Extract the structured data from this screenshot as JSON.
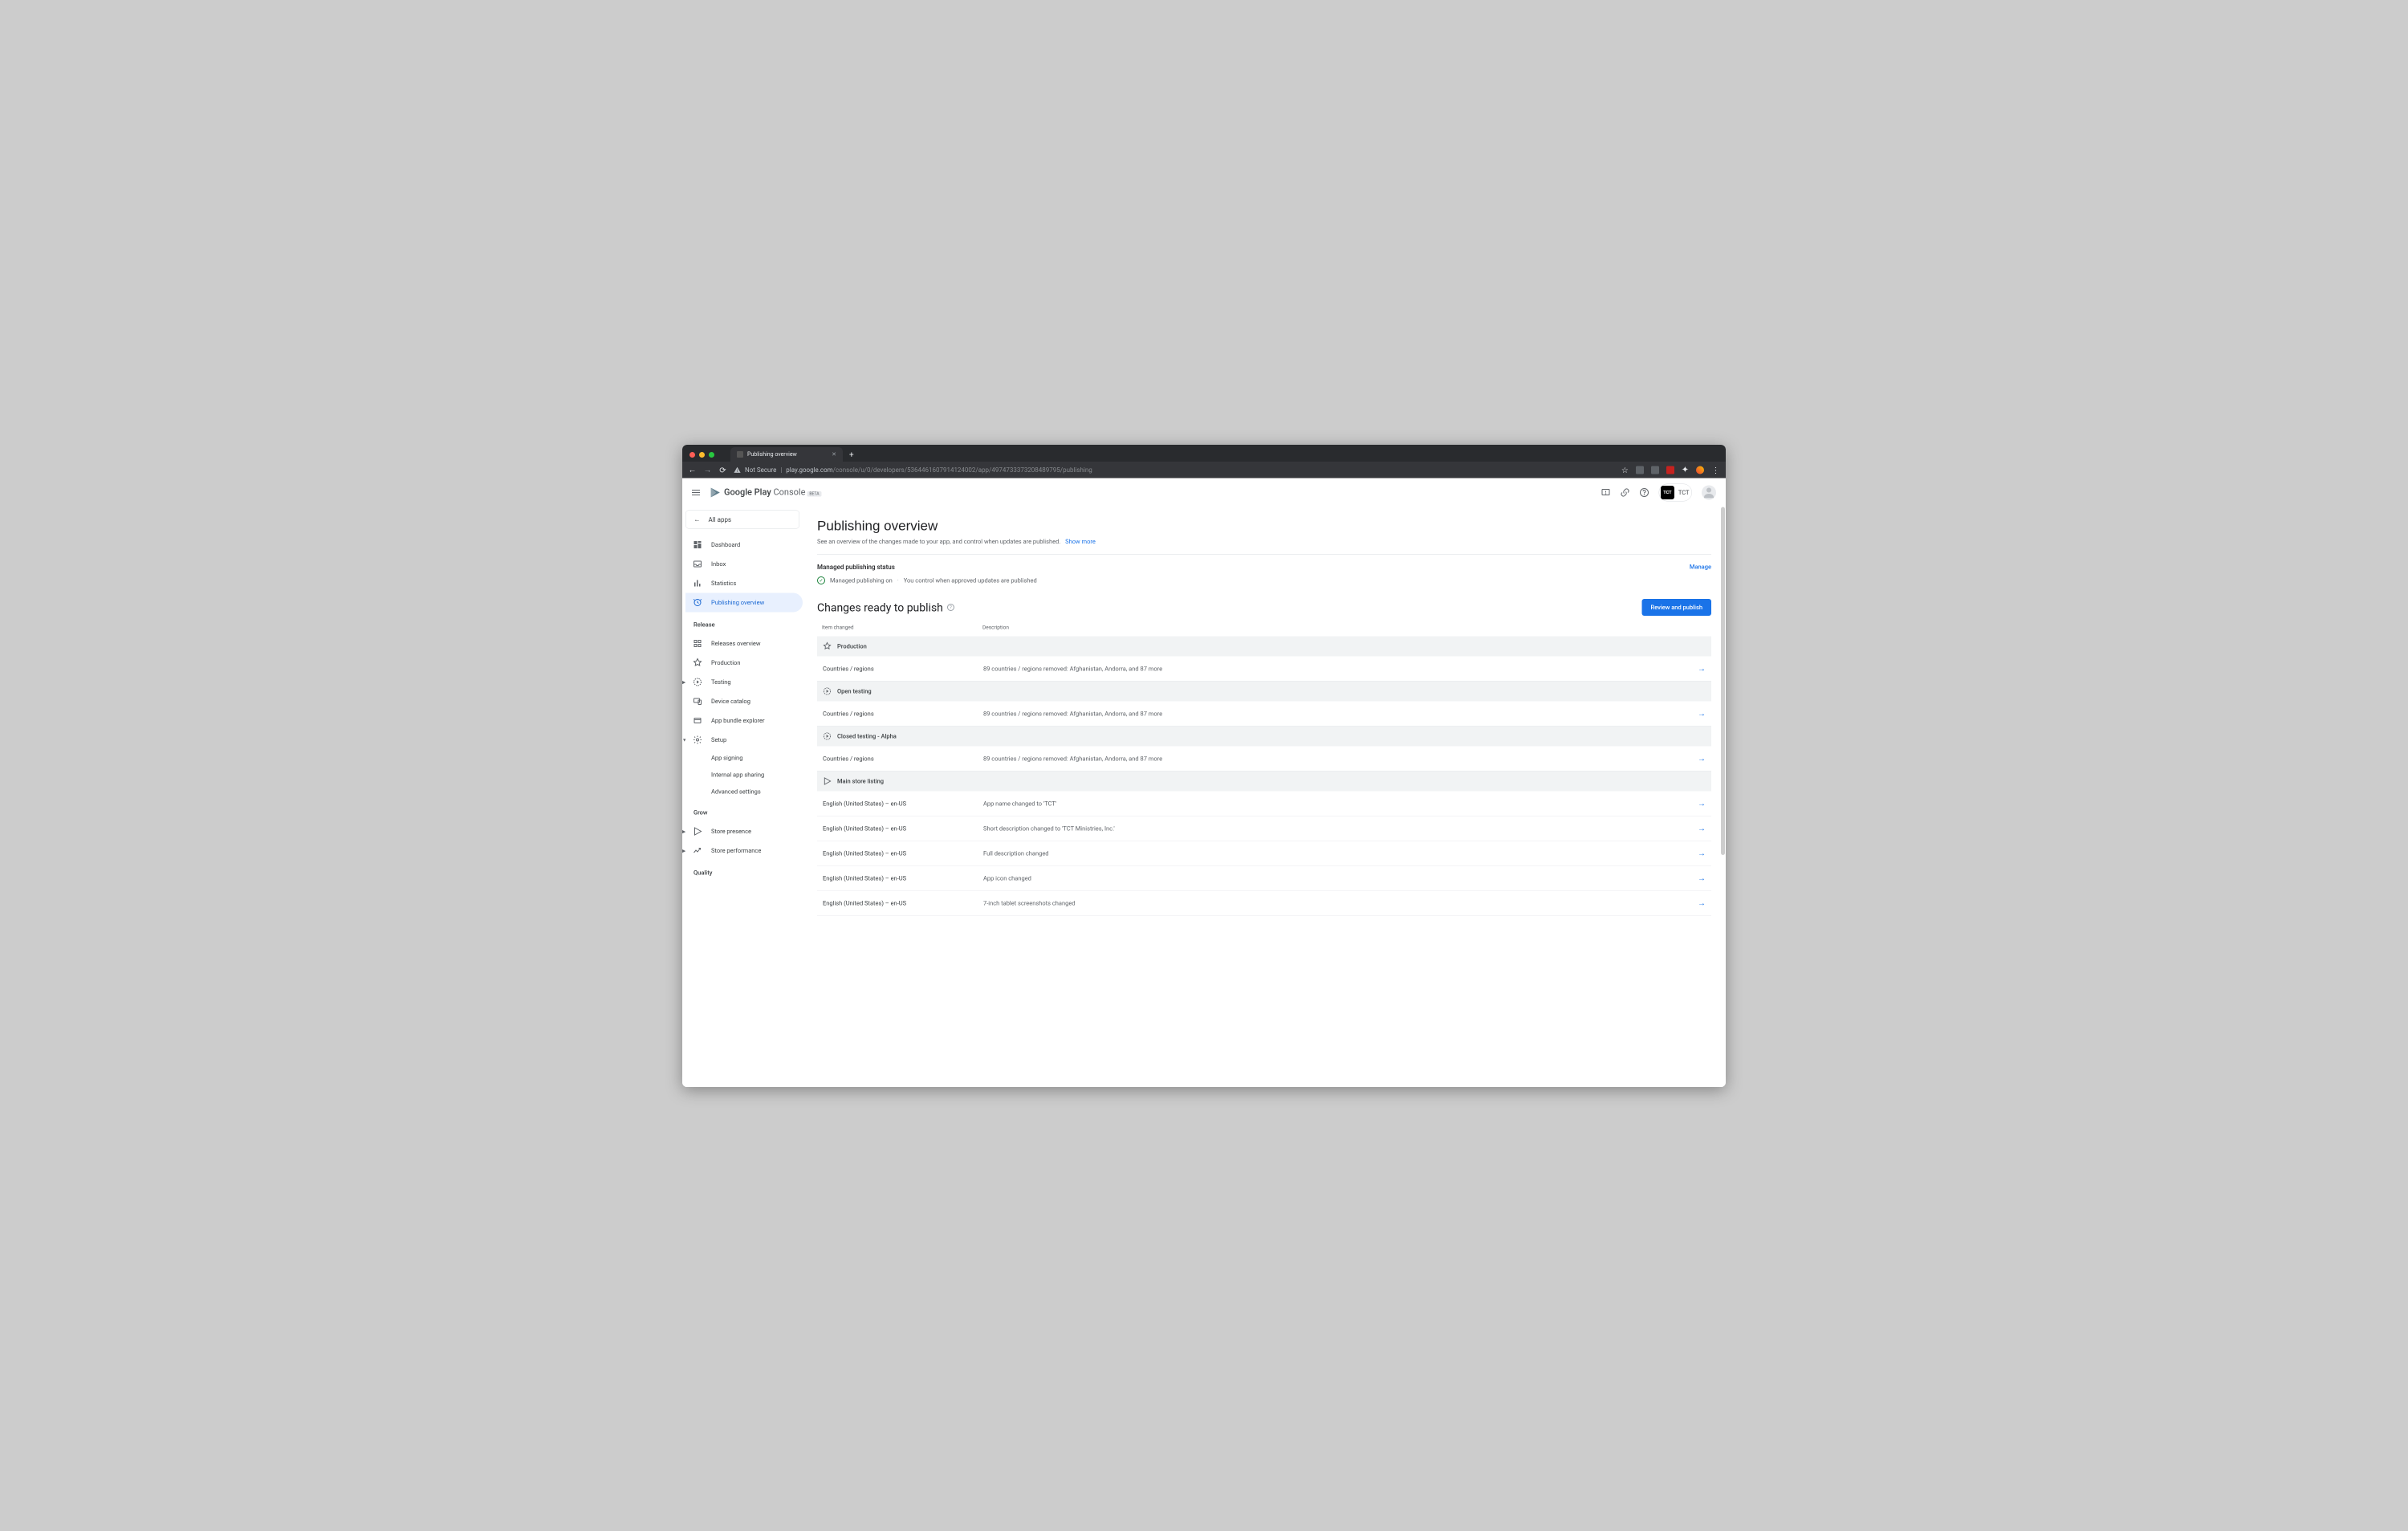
{
  "browser": {
    "tab_title": "Publishing overview",
    "not_secure": "Not Secure",
    "url_host": "play.google.com",
    "url_path": "/console/u/0/developers/5364461607914124002/app/4974733373208489795/publishing"
  },
  "appbar": {
    "logo_bold": "Google Play",
    "logo_light": "Console",
    "beta": "BETA",
    "account_short": "TCT",
    "account_label": "TCT"
  },
  "sidebar": {
    "all_apps": "All apps",
    "items_top": [
      {
        "label": "Dashboard",
        "icon": "dashboard"
      },
      {
        "label": "Inbox",
        "icon": "inbox"
      },
      {
        "label": "Statistics",
        "icon": "stats"
      },
      {
        "label": "Publishing overview",
        "icon": "publishing",
        "active": true
      }
    ],
    "section_release": "Release",
    "items_release": [
      {
        "label": "Releases overview",
        "icon": "releases"
      },
      {
        "label": "Production",
        "icon": "production"
      },
      {
        "label": "Testing",
        "icon": "testing",
        "expandable": true
      },
      {
        "label": "Device catalog",
        "icon": "device"
      },
      {
        "label": "App bundle explorer",
        "icon": "bundle"
      },
      {
        "label": "Setup",
        "icon": "setup",
        "expandable": true,
        "expanded": true
      }
    ],
    "items_setup_sub": [
      {
        "label": "App signing"
      },
      {
        "label": "Internal app sharing"
      },
      {
        "label": "Advanced settings"
      }
    ],
    "section_grow": "Grow",
    "items_grow": [
      {
        "label": "Store presence",
        "icon": "store",
        "expandable": true
      },
      {
        "label": "Store performance",
        "icon": "perf",
        "expandable": true
      }
    ],
    "section_quality": "Quality"
  },
  "page": {
    "title": "Publishing overview",
    "subtitle": "See an overview of the changes made to your app, and control when updates are published.",
    "show_more": "Show more",
    "managed_status_heading": "Managed publishing status",
    "manage_link": "Manage",
    "managed_on": "Managed publishing on",
    "managed_desc": "You control when approved updates are published",
    "changes_heading": "Changes ready to publish",
    "review_btn": "Review and publish",
    "col_item": "Item changed",
    "col_desc": "Description",
    "groups": [
      {
        "label": "Production",
        "icon": "production",
        "rows": [
          {
            "item": "Countries / regions",
            "desc": "89 countries / regions removed: Afghanistan, Andorra, and 87 more"
          }
        ]
      },
      {
        "label": "Open testing",
        "icon": "testing",
        "rows": [
          {
            "item": "Countries / regions",
            "desc": "89 countries / regions removed: Afghanistan, Andorra, and 87 more"
          }
        ]
      },
      {
        "label": "Closed testing - Alpha",
        "icon": "testing",
        "rows": [
          {
            "item": "Countries / regions",
            "desc": "89 countries / regions removed: Afghanistan, Andorra, and 87 more"
          }
        ]
      },
      {
        "label": "Main store listing",
        "icon": "store",
        "rows": [
          {
            "item": "English (United States) – en-US",
            "desc": "App name changed to 'TCT'"
          },
          {
            "item": "English (United States) – en-US",
            "desc": "Short description changed to 'TCT Ministries, Inc.'"
          },
          {
            "item": "English (United States) – en-US",
            "desc": "Full description changed"
          },
          {
            "item": "English (United States) – en-US",
            "desc": "App icon changed"
          },
          {
            "item": "English (United States) – en-US",
            "desc": "7-inch tablet screenshots changed"
          }
        ]
      }
    ]
  }
}
